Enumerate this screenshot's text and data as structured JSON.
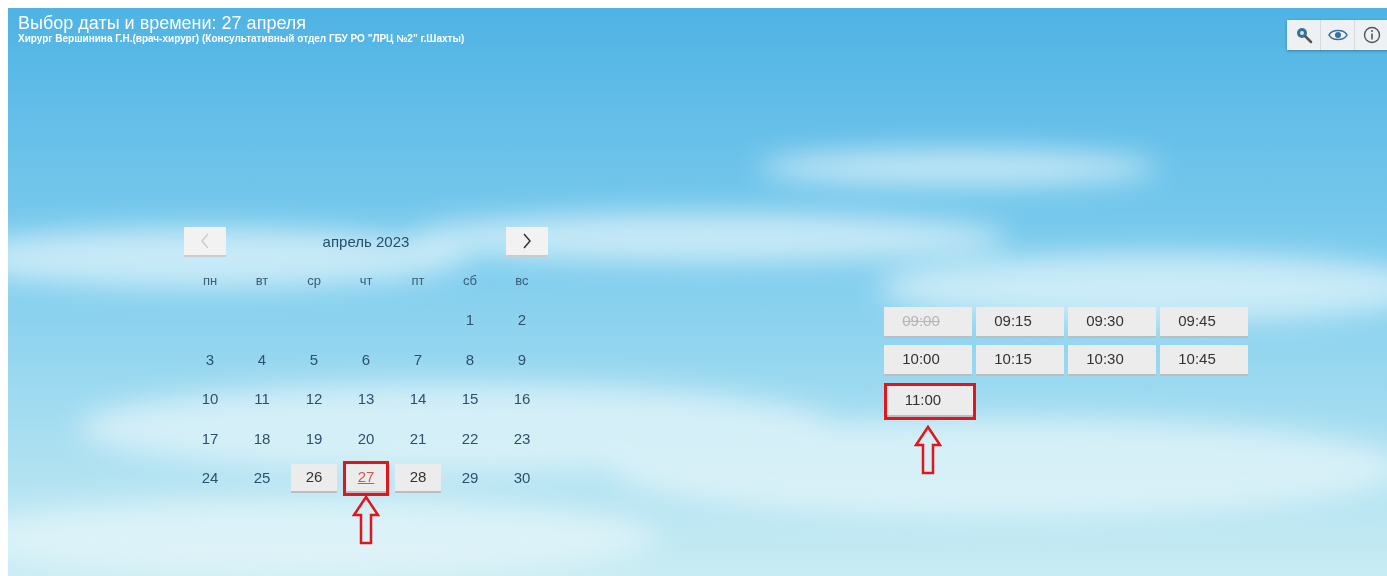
{
  "header": {
    "title": "Выбор даты и времени: 27 апреля",
    "subtitle": "Хирург Вершинина Г.Н.(врач-хирург) (Консультативный отдел ГБУ РО \"ЛРЦ №2\" г.Шахты)"
  },
  "toolbar": [
    {
      "kind": "search"
    },
    {
      "kind": "eye"
    },
    {
      "kind": "info"
    }
  ],
  "calendar": {
    "month": "апрель 2023",
    "prev_disabled": true,
    "next_disabled": false,
    "weekdays": [
      "пн",
      "вт",
      "ср",
      "чт",
      "пт",
      "сб",
      "вс"
    ],
    "weeks": [
      [
        {
          "day": "1",
          "available": false,
          "selected": false,
          "annotated": false
        },
        {
          "day": "2",
          "available": false,
          "selected": false,
          "annotated": false
        }
      ],
      [
        {
          "day": "3",
          "available": false,
          "selected": false,
          "annotated": false
        },
        {
          "day": "4",
          "available": false,
          "selected": false,
          "annotated": false
        },
        {
          "day": "5",
          "available": false,
          "selected": false,
          "annotated": false
        },
        {
          "day": "6",
          "available": false,
          "selected": false,
          "annotated": false
        },
        {
          "day": "7",
          "available": false,
          "selected": false,
          "annotated": false
        },
        {
          "day": "8",
          "available": false,
          "selected": false,
          "annotated": false
        },
        {
          "day": "9",
          "available": false,
          "selected": false,
          "annotated": false
        }
      ],
      [
        {
          "day": "10",
          "available": false,
          "selected": false,
          "annotated": false
        },
        {
          "day": "11",
          "available": false,
          "selected": false,
          "annotated": false
        },
        {
          "day": "12",
          "available": false,
          "selected": false,
          "annotated": false
        },
        {
          "day": "13",
          "available": false,
          "selected": false,
          "annotated": false
        },
        {
          "day": "14",
          "available": false,
          "selected": false,
          "annotated": false
        },
        {
          "day": "15",
          "available": false,
          "selected": false,
          "annotated": false
        },
        {
          "day": "16",
          "available": false,
          "selected": false,
          "annotated": false
        }
      ],
      [
        {
          "day": "17",
          "available": false,
          "selected": false,
          "annotated": false
        },
        {
          "day": "18",
          "available": false,
          "selected": false,
          "annotated": false
        },
        {
          "day": "19",
          "available": false,
          "selected": false,
          "annotated": false
        },
        {
          "day": "20",
          "available": false,
          "selected": false,
          "annotated": false
        },
        {
          "day": "21",
          "available": false,
          "selected": false,
          "annotated": false
        },
        {
          "day": "22",
          "available": false,
          "selected": false,
          "annotated": false
        },
        {
          "day": "23",
          "available": false,
          "selected": false,
          "annotated": false
        }
      ],
      [
        {
          "day": "24",
          "available": false,
          "selected": false,
          "annotated": false
        },
        {
          "day": "25",
          "available": false,
          "selected": false,
          "annotated": false
        },
        {
          "day": "26",
          "available": true,
          "selected": false,
          "annotated": false
        },
        {
          "day": "27",
          "available": true,
          "selected": true,
          "annotated": true
        },
        {
          "day": "28",
          "available": true,
          "selected": false,
          "annotated": false
        },
        {
          "day": "29",
          "available": false,
          "selected": false,
          "annotated": false
        },
        {
          "day": "30",
          "available": false,
          "selected": false,
          "annotated": false
        }
      ]
    ]
  },
  "slots": [
    {
      "time": "09:00",
      "disabled": true,
      "annotated": false
    },
    {
      "time": "09:15",
      "disabled": false,
      "annotated": false
    },
    {
      "time": "09:30",
      "disabled": false,
      "annotated": false
    },
    {
      "time": "09:45",
      "disabled": false,
      "annotated": false
    },
    {
      "time": "10:00",
      "disabled": false,
      "annotated": false
    },
    {
      "time": "10:15",
      "disabled": false,
      "annotated": false
    },
    {
      "time": "10:30",
      "disabled": false,
      "annotated": false
    },
    {
      "time": "10:45",
      "disabled": false,
      "annotated": false
    },
    {
      "time": "11:00",
      "disabled": false,
      "annotated": true
    }
  ]
}
